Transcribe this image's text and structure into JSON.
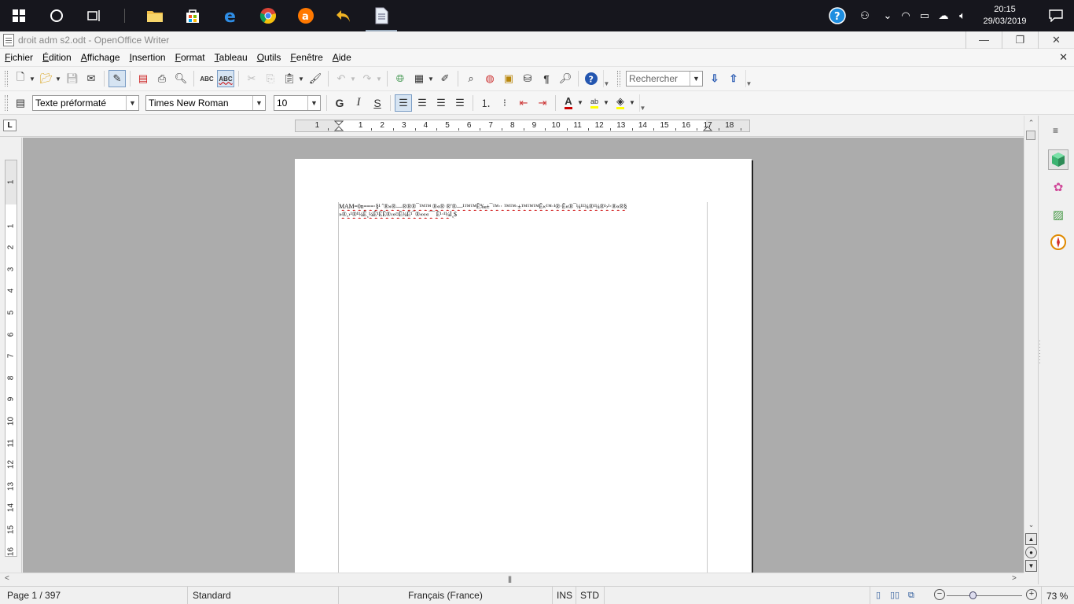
{
  "taskbar": {
    "clock_time": "20:15",
    "clock_date": "29/03/2019"
  },
  "window": {
    "title": "droit adm s2.odt - OpenOffice Writer"
  },
  "menu": {
    "items": [
      "Fichier",
      "Édition",
      "Affichage",
      "Insertion",
      "Format",
      "Tableau",
      "Outils",
      "Fenêtre",
      "Aide"
    ]
  },
  "toolbar": {
    "search_placeholder": "Rechercher",
    "paragraph_style": "Texte préformaté",
    "font_name": "Times New Roman",
    "font_size": "10",
    "bold_label": "G",
    "italic_label": "I",
    "underline_label": "S"
  },
  "ruler": {
    "h_numbers": [
      "1",
      "1",
      "2",
      "3",
      "4",
      "5",
      "6",
      "7",
      "8",
      "9",
      "10",
      "11",
      "12",
      "13",
      "14",
      "15",
      "16",
      "17",
      "18"
    ],
    "v_numbers": [
      "1",
      "1",
      "2",
      "3",
      "4",
      "5",
      "6",
      "7",
      "8",
      "9",
      "10",
      "11",
      "12",
      "13",
      "14",
      "15",
      "16"
    ]
  },
  "document": {
    "line1": "MAM=0n===·§¹ ˆ®»®—®®®¯™™ ®«® ®ʹ®—¹™™Ê‰±¯™·· ™™·±™™™Ê«™·¹®·Ê«®¯¼¹¹¾®¹¼®¹›¹·®«®§",
    "line2": "»®‚›¹®¹¼Ê¸¼Ê¹ÈÊ®›»¤Ê¾Ë¹¯®«««¯¯     Ë¹·¹¼Ì¸$"
  },
  "status": {
    "page": "Page 1 / 397",
    "style": "Standard",
    "language": "Français (France)",
    "insert_mode": "INS",
    "selection_mode": "STD",
    "zoom": "73 %"
  }
}
